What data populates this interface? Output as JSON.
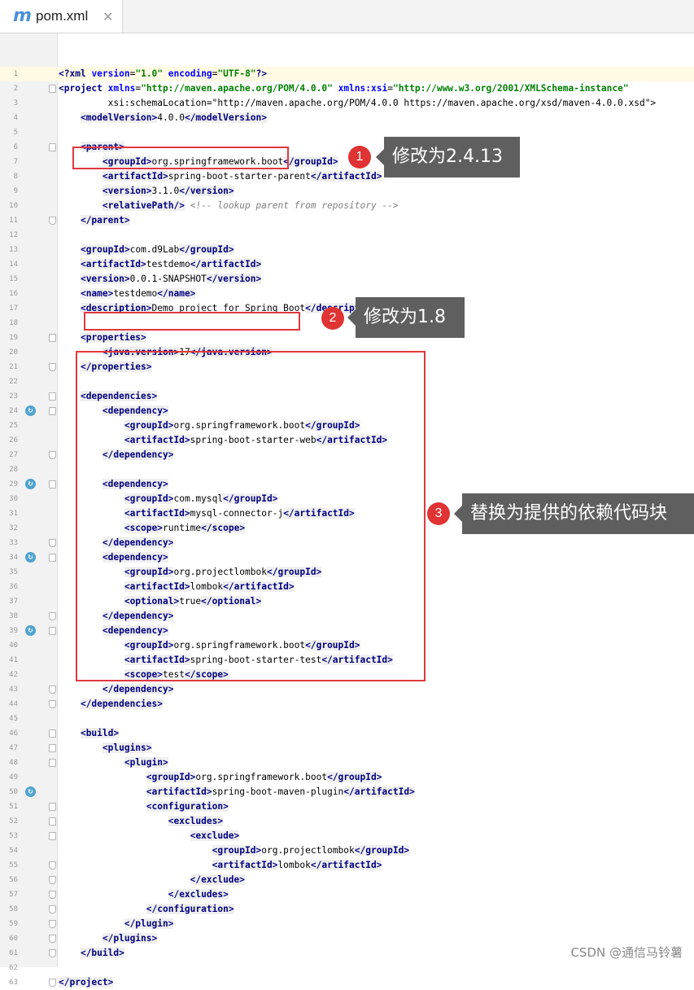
{
  "tab": {
    "icon": "m",
    "filename": "pom.xml",
    "close": "✕"
  },
  "lines": [
    "<?xml version=\"1.0\" encoding=\"UTF-8\"?>",
    "<project xmlns=\"http://maven.apache.org/POM/4.0.0\" xmlns:xsi=\"http://www.w3.org/2001/XMLSchema-instance\"",
    "         xsi:schemaLocation=\"http://maven.apache.org/POM/4.0.0 https://maven.apache.org/xsd/maven-4.0.0.xsd\">",
    "    <modelVersion>4.0.0</modelVersion>",
    "",
    "    <parent>",
    "        <groupId>org.springframework.boot</groupId>",
    "        <artifactId>spring-boot-starter-parent</artifactId>",
    "        <version>3.1.0</version>",
    "        <relativePath/> <!-- lookup parent from repository -->",
    "    </parent>",
    "",
    "    <groupId>com.d9Lab</groupId>",
    "    <artifactId>testdemo</artifactId>",
    "    <version>0.0.1-SNAPSHOT</version>",
    "    <name>testdemo</name>",
    "    <description>Demo project for Spring Boot</description>",
    "",
    "    <properties>",
    "        <java.version>17</java.version>",
    "    </properties>",
    "",
    "    <dependencies>",
    "        <dependency>",
    "            <groupId>org.springframework.boot</groupId>",
    "            <artifactId>spring-boot-starter-web</artifactId>",
    "        </dependency>",
    "",
    "        <dependency>",
    "            <groupId>com.mysql</groupId>",
    "            <artifactId>mysql-connector-j</artifactId>",
    "            <scope>runtime</scope>",
    "        </dependency>",
    "        <dependency>",
    "            <groupId>org.projectlombok</groupId>",
    "            <artifactId>lombok</artifactId>",
    "            <optional>true</optional>",
    "        </dependency>",
    "        <dependency>",
    "            <groupId>org.springframework.boot</groupId>",
    "            <artifactId>spring-boot-starter-test</artifactId>",
    "            <scope>test</scope>",
    "        </dependency>",
    "    </dependencies>",
    "",
    "    <build>",
    "        <plugins>",
    "            <plugin>",
    "                <groupId>org.springframework.boot</groupId>",
    "                <artifactId>spring-boot-maven-plugin</artifactId>",
    "                <configuration>",
    "                    <excludes>",
    "                        <exclude>",
    "                            <groupId>org.projectlombok</groupId>",
    "                            <artifactId>lombok</artifactId>",
    "                        </exclude>",
    "                    </excludes>",
    "                </configuration>",
    "            </plugin>",
    "        </plugins>",
    "    </build>",
    "",
    "</project>"
  ],
  "fold_open_lines": [
    2,
    6,
    19,
    23,
    24,
    29,
    34,
    39,
    46,
    47,
    48,
    51,
    52,
    53
  ],
  "fold_end_lines": [
    11,
    21,
    27,
    33,
    38,
    43,
    44,
    55,
    56,
    57,
    58,
    59,
    60,
    61,
    63
  ],
  "gutter_marker_lines": [
    24,
    29,
    34,
    39,
    50
  ],
  "gutter_marker_icon": "maven-dependency-icon",
  "current_line": 1,
  "annotations": [
    {
      "number": "1",
      "text": "修改为2.4.13"
    },
    {
      "number": "2",
      "text": "修改为1.8"
    },
    {
      "number": "3",
      "text": "替换为提供的依赖代码块"
    }
  ],
  "watermark": "CSDN @通信马铃薯"
}
